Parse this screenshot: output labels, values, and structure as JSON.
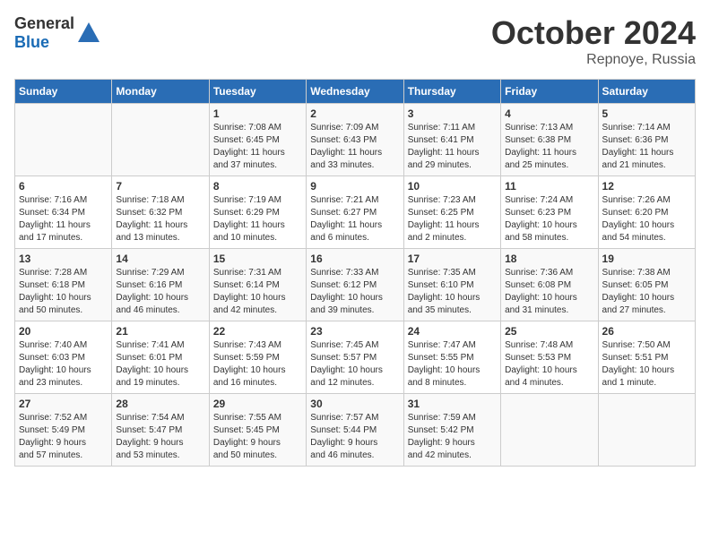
{
  "header": {
    "logo_general": "General",
    "logo_blue": "Blue",
    "month": "October 2024",
    "location": "Repnoye, Russia"
  },
  "days_of_week": [
    "Sunday",
    "Monday",
    "Tuesday",
    "Wednesday",
    "Thursday",
    "Friday",
    "Saturday"
  ],
  "weeks": [
    [
      {
        "day": "",
        "content": ""
      },
      {
        "day": "",
        "content": ""
      },
      {
        "day": "1",
        "content": "Sunrise: 7:08 AM\nSunset: 6:45 PM\nDaylight: 11 hours\nand 37 minutes."
      },
      {
        "day": "2",
        "content": "Sunrise: 7:09 AM\nSunset: 6:43 PM\nDaylight: 11 hours\nand 33 minutes."
      },
      {
        "day": "3",
        "content": "Sunrise: 7:11 AM\nSunset: 6:41 PM\nDaylight: 11 hours\nand 29 minutes."
      },
      {
        "day": "4",
        "content": "Sunrise: 7:13 AM\nSunset: 6:38 PM\nDaylight: 11 hours\nand 25 minutes."
      },
      {
        "day": "5",
        "content": "Sunrise: 7:14 AM\nSunset: 6:36 PM\nDaylight: 11 hours\nand 21 minutes."
      }
    ],
    [
      {
        "day": "6",
        "content": "Sunrise: 7:16 AM\nSunset: 6:34 PM\nDaylight: 11 hours\nand 17 minutes."
      },
      {
        "day": "7",
        "content": "Sunrise: 7:18 AM\nSunset: 6:32 PM\nDaylight: 11 hours\nand 13 minutes."
      },
      {
        "day": "8",
        "content": "Sunrise: 7:19 AM\nSunset: 6:29 PM\nDaylight: 11 hours\nand 10 minutes."
      },
      {
        "day": "9",
        "content": "Sunrise: 7:21 AM\nSunset: 6:27 PM\nDaylight: 11 hours\nand 6 minutes."
      },
      {
        "day": "10",
        "content": "Sunrise: 7:23 AM\nSunset: 6:25 PM\nDaylight: 11 hours\nand 2 minutes."
      },
      {
        "day": "11",
        "content": "Sunrise: 7:24 AM\nSunset: 6:23 PM\nDaylight: 10 hours\nand 58 minutes."
      },
      {
        "day": "12",
        "content": "Sunrise: 7:26 AM\nSunset: 6:20 PM\nDaylight: 10 hours\nand 54 minutes."
      }
    ],
    [
      {
        "day": "13",
        "content": "Sunrise: 7:28 AM\nSunset: 6:18 PM\nDaylight: 10 hours\nand 50 minutes."
      },
      {
        "day": "14",
        "content": "Sunrise: 7:29 AM\nSunset: 6:16 PM\nDaylight: 10 hours\nand 46 minutes."
      },
      {
        "day": "15",
        "content": "Sunrise: 7:31 AM\nSunset: 6:14 PM\nDaylight: 10 hours\nand 42 minutes."
      },
      {
        "day": "16",
        "content": "Sunrise: 7:33 AM\nSunset: 6:12 PM\nDaylight: 10 hours\nand 39 minutes."
      },
      {
        "day": "17",
        "content": "Sunrise: 7:35 AM\nSunset: 6:10 PM\nDaylight: 10 hours\nand 35 minutes."
      },
      {
        "day": "18",
        "content": "Sunrise: 7:36 AM\nSunset: 6:08 PM\nDaylight: 10 hours\nand 31 minutes."
      },
      {
        "day": "19",
        "content": "Sunrise: 7:38 AM\nSunset: 6:05 PM\nDaylight: 10 hours\nand 27 minutes."
      }
    ],
    [
      {
        "day": "20",
        "content": "Sunrise: 7:40 AM\nSunset: 6:03 PM\nDaylight: 10 hours\nand 23 minutes."
      },
      {
        "day": "21",
        "content": "Sunrise: 7:41 AM\nSunset: 6:01 PM\nDaylight: 10 hours\nand 19 minutes."
      },
      {
        "day": "22",
        "content": "Sunrise: 7:43 AM\nSunset: 5:59 PM\nDaylight: 10 hours\nand 16 minutes."
      },
      {
        "day": "23",
        "content": "Sunrise: 7:45 AM\nSunset: 5:57 PM\nDaylight: 10 hours\nand 12 minutes."
      },
      {
        "day": "24",
        "content": "Sunrise: 7:47 AM\nSunset: 5:55 PM\nDaylight: 10 hours\nand 8 minutes."
      },
      {
        "day": "25",
        "content": "Sunrise: 7:48 AM\nSunset: 5:53 PM\nDaylight: 10 hours\nand 4 minutes."
      },
      {
        "day": "26",
        "content": "Sunrise: 7:50 AM\nSunset: 5:51 PM\nDaylight: 10 hours\nand 1 minute."
      }
    ],
    [
      {
        "day": "27",
        "content": "Sunrise: 7:52 AM\nSunset: 5:49 PM\nDaylight: 9 hours\nand 57 minutes."
      },
      {
        "day": "28",
        "content": "Sunrise: 7:54 AM\nSunset: 5:47 PM\nDaylight: 9 hours\nand 53 minutes."
      },
      {
        "day": "29",
        "content": "Sunrise: 7:55 AM\nSunset: 5:45 PM\nDaylight: 9 hours\nand 50 minutes."
      },
      {
        "day": "30",
        "content": "Sunrise: 7:57 AM\nSunset: 5:44 PM\nDaylight: 9 hours\nand 46 minutes."
      },
      {
        "day": "31",
        "content": "Sunrise: 7:59 AM\nSunset: 5:42 PM\nDaylight: 9 hours\nand 42 minutes."
      },
      {
        "day": "",
        "content": ""
      },
      {
        "day": "",
        "content": ""
      }
    ]
  ]
}
